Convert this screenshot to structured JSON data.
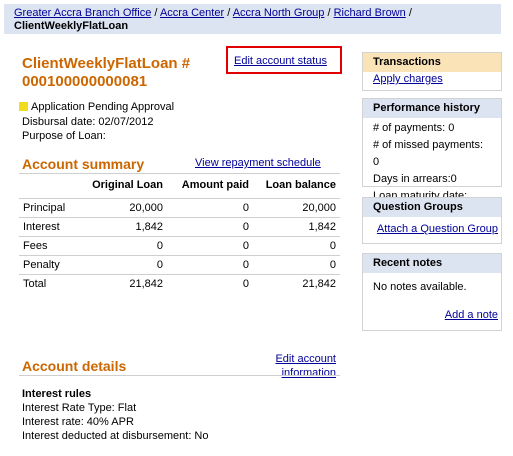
{
  "breadcrumb": {
    "items": [
      "Greater Accra Branch Office",
      "Accra Center",
      "Accra North Group",
      "Richard Brown"
    ],
    "separator": "/",
    "current": "ClientWeeklyFlatLoan"
  },
  "loan": {
    "title": "ClientWeeklyFlatLoan # 000100000000081",
    "edit_status_label": "Edit account status",
    "status": "Application Pending Approval",
    "status_color": "#f2dc1e",
    "disbursal_date": "Disbursal date: 02/07/2012",
    "purpose": "Purpose of Loan:"
  },
  "summary": {
    "heading": "Account summary",
    "repayment_link": "View repayment schedule",
    "columns": [
      "",
      "Original Loan",
      "Amount paid",
      "Loan balance"
    ],
    "rows": [
      {
        "label": "Principal",
        "original": "20,000",
        "paid": "0",
        "balance": "20,000"
      },
      {
        "label": "Interest",
        "original": "1,842",
        "paid": "0",
        "balance": "1,842"
      },
      {
        "label": "Fees",
        "original": "0",
        "paid": "0",
        "balance": "0"
      },
      {
        "label": "Penalty",
        "original": "0",
        "paid": "0",
        "balance": "0"
      },
      {
        "label": "Total",
        "original": "21,842",
        "paid": "0",
        "balance": "21,842"
      }
    ]
  },
  "details": {
    "heading": "Account details",
    "edit_info_line1": "Edit account",
    "edit_info_line2": "information",
    "rules_title": "Interest rules",
    "rate_type": "Interest Rate Type:  Flat",
    "rate": "Interest rate: 40% APR",
    "deducted": "Interest deducted at disbursement: No"
  },
  "sidebar": {
    "transactions": {
      "title": "Transactions",
      "link": "Apply charges"
    },
    "performance": {
      "title": "Performance history",
      "lines": [
        "# of payments: 0",
        "# of missed payments: 0",
        "Days in arrears:0",
        "Loan maturity date:"
      ]
    },
    "questions": {
      "title": "Question Groups",
      "link": "Attach a Question Group"
    },
    "notes": {
      "title": "Recent notes",
      "empty": "No notes available.",
      "link": "Add a note"
    }
  },
  "colors": {
    "accent_orange": "#cc6600",
    "link_blue": "#000099",
    "panel_header_blue": "#dde4f1",
    "panel_header_orange": "#fbe3b8",
    "highlight_red": "#e00000"
  }
}
